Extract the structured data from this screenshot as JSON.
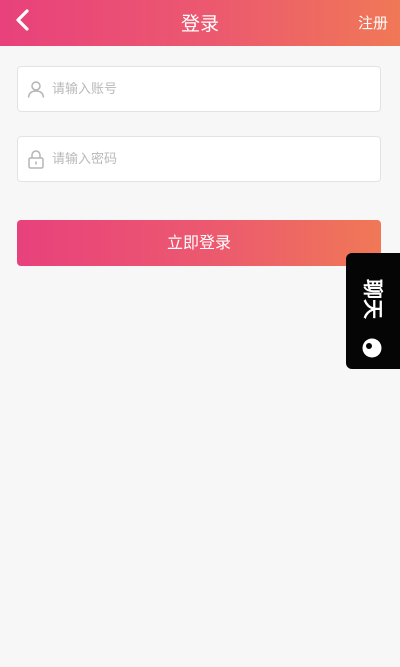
{
  "header": {
    "title": "登录",
    "register_label": "注册",
    "back_icon": "chevron-left-icon"
  },
  "form": {
    "account": {
      "icon": "user-icon",
      "placeholder": "请输入账号",
      "value": ""
    },
    "password": {
      "icon": "lock-icon",
      "placeholder": "请输入密码",
      "value": ""
    },
    "submit_label": "立即登录"
  },
  "chat_widget": {
    "label": "聊天",
    "icon": "chat-bubble-icon"
  },
  "colors": {
    "gradient_start": "#e8417c",
    "gradient_end": "#f07856",
    "background": "#f7f7f7",
    "chat_tab": "#050505"
  }
}
